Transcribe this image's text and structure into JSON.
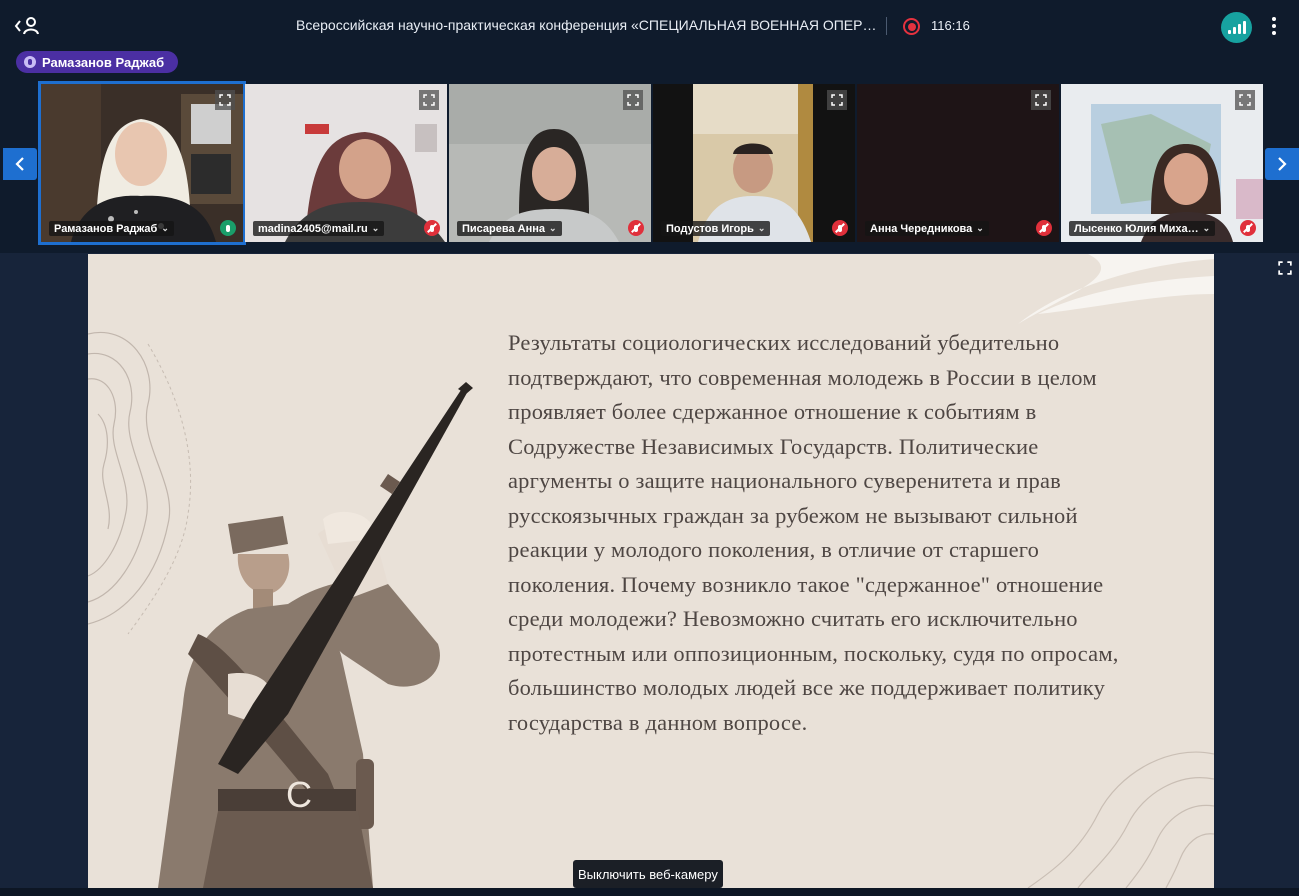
{
  "header": {
    "title": "Всероссийская научно-практическая конференция «СПЕЦИАЛЬНАЯ ВОЕННАЯ ОПЕР…",
    "timer": "116:16",
    "icons": {
      "back": "back-user-icon",
      "record": "record-icon",
      "signal": "signal-icon",
      "more": "more-vertical-icon"
    },
    "colors": {
      "record": "#e5323f",
      "signal": "#17a2a0"
    }
  },
  "active_speaker": {
    "name": "Рамазанов Раджаб"
  },
  "participants": [
    {
      "name": "Рамазанов Раджаб",
      "mic": "on",
      "active": true
    },
    {
      "name": "madina2405@mail.ru",
      "mic": "off",
      "active": false
    },
    {
      "name": "Писарева Анна",
      "mic": "off",
      "active": false
    },
    {
      "name": "Подустов Игорь",
      "mic": "off",
      "active": false
    },
    {
      "name": "Анна Чередникова",
      "mic": "off",
      "active": false
    },
    {
      "name": "Лысенко Юлия Миха…",
      "mic": "off",
      "active": false
    }
  ],
  "slide": {
    "text": "Результаты социологических исследований убедительно подтверждают, что современная молодежь в России в целом проявляет более сдержанное отношение к событиям в Содружестве Независимых Государств. Политические аргументы о защите национального суверенитета и прав русскоязычных граждан за рубежом не вызывают сильной реакции у молодого поколения, в отличие от старшего поколения. Почему возникло такое \"сдержанное\" отношение среди молодежи? Невозможно считать его исключительно протестным или оппозиционным, поскольку, судя по опросам, большинство молодых людей все же поддерживает политику государства в данном вопросе.",
    "accent": "#4e4643",
    "background": "#e9e1d8"
  },
  "tooltip": {
    "text": "Выключить веб-камеру"
  }
}
